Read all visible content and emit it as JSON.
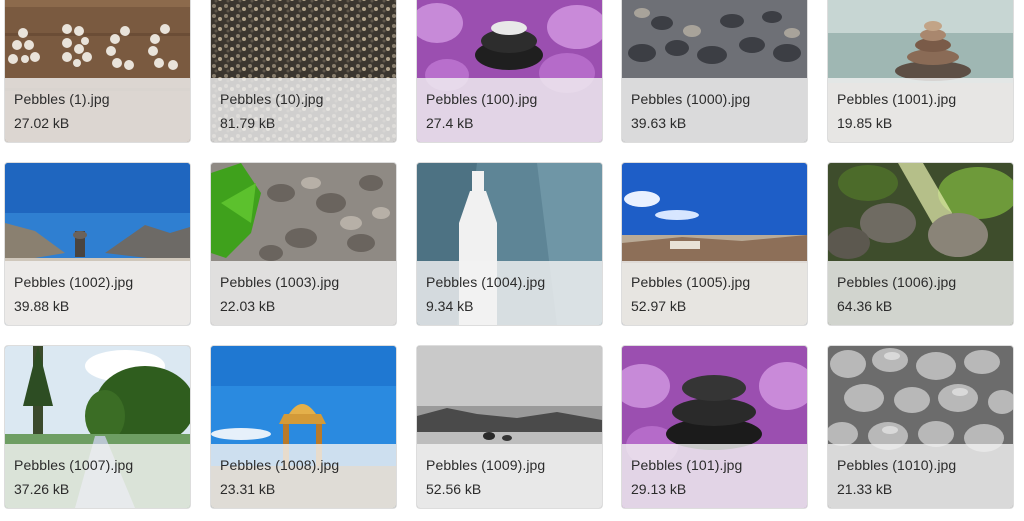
{
  "files": [
    {
      "name": "Pebbles (1).jpg",
      "size": "27.02 kB",
      "thumb": "pebble letters on wood"
    },
    {
      "name": "Pebbles (10).jpg",
      "size": "81.79 kB",
      "thumb": "gravel texture"
    },
    {
      "name": "Pebbles (100).jpg",
      "size": "27.4 kB",
      "thumb": "stacked stones with orchids"
    },
    {
      "name": "Pebbles (1000).jpg",
      "size": "39.63 kB",
      "thumb": "wet pebbles"
    },
    {
      "name": "Pebbles (1001).jpg",
      "size": "19.85 kB",
      "thumb": "stone cairn by water"
    },
    {
      "name": "Pebbles (1002).jpg",
      "size": "39.88 kB",
      "thumb": "cairn with mountains"
    },
    {
      "name": "Pebbles (1003).jpg",
      "size": "22.03 kB",
      "thumb": "green leaf on gravel"
    },
    {
      "name": "Pebbles (1004).jpg",
      "size": "9.34 kB",
      "thumb": "white bottle on fabric"
    },
    {
      "name": "Pebbles (1005).jpg",
      "size": "52.97 kB",
      "thumb": "blue sky landscape"
    },
    {
      "name": "Pebbles (1006).jpg",
      "size": "64.36 kB",
      "thumb": "rock garden with sunlight"
    },
    {
      "name": "Pebbles (1007).jpg",
      "size": "37.26 kB",
      "thumb": "park path with trees"
    },
    {
      "name": "Pebbles (1008).jpg",
      "size": "23.31 kB",
      "thumb": "canopy monument under blue sky"
    },
    {
      "name": "Pebbles (1009).jpg",
      "size": "52.56 kB",
      "thumb": "monochrome pebble beach"
    },
    {
      "name": "Pebbles (101).jpg",
      "size": "29.13 kB",
      "thumb": "black stones with orchids"
    },
    {
      "name": "Pebbles (1010).jpg",
      "size": "21.33 kB",
      "thumb": "grey pebbles"
    }
  ]
}
